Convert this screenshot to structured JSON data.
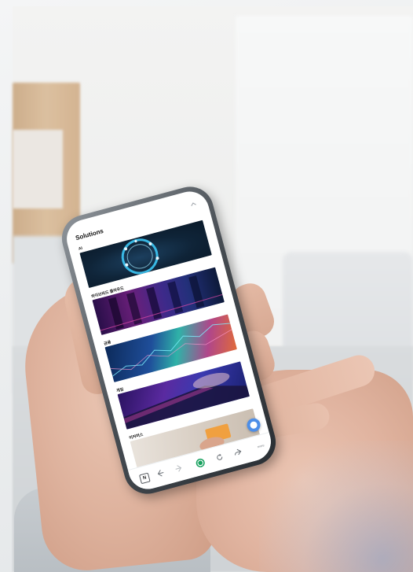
{
  "app": {
    "title": "Solutions",
    "collapse_icon": "chevron-up-icon"
  },
  "sections": [
    {
      "label": "AI",
      "image": "ai-server-ring-image"
    },
    {
      "label": "하이브리드 클라우드",
      "image": "data-center-image"
    },
    {
      "label": "금융",
      "image": "financial-chart-image"
    },
    {
      "label": "게임",
      "image": "gaming-keyboard-image"
    },
    {
      "label": "이커머스",
      "image": "credit-card-image"
    }
  ],
  "bottom_nav": {
    "n_icon": "N",
    "back_icon": "back-arrow-icon",
    "forward_icon": "forward-arrow-icon",
    "home_icon": "home-icon",
    "refresh_icon": "refresh-icon",
    "share_icon": "share-icon",
    "more_label": "more"
  },
  "chat_button_icon": "chatbot-icon",
  "colors": {
    "accent_green": "#1aa260",
    "chat_blue": "#4d8ee8"
  }
}
